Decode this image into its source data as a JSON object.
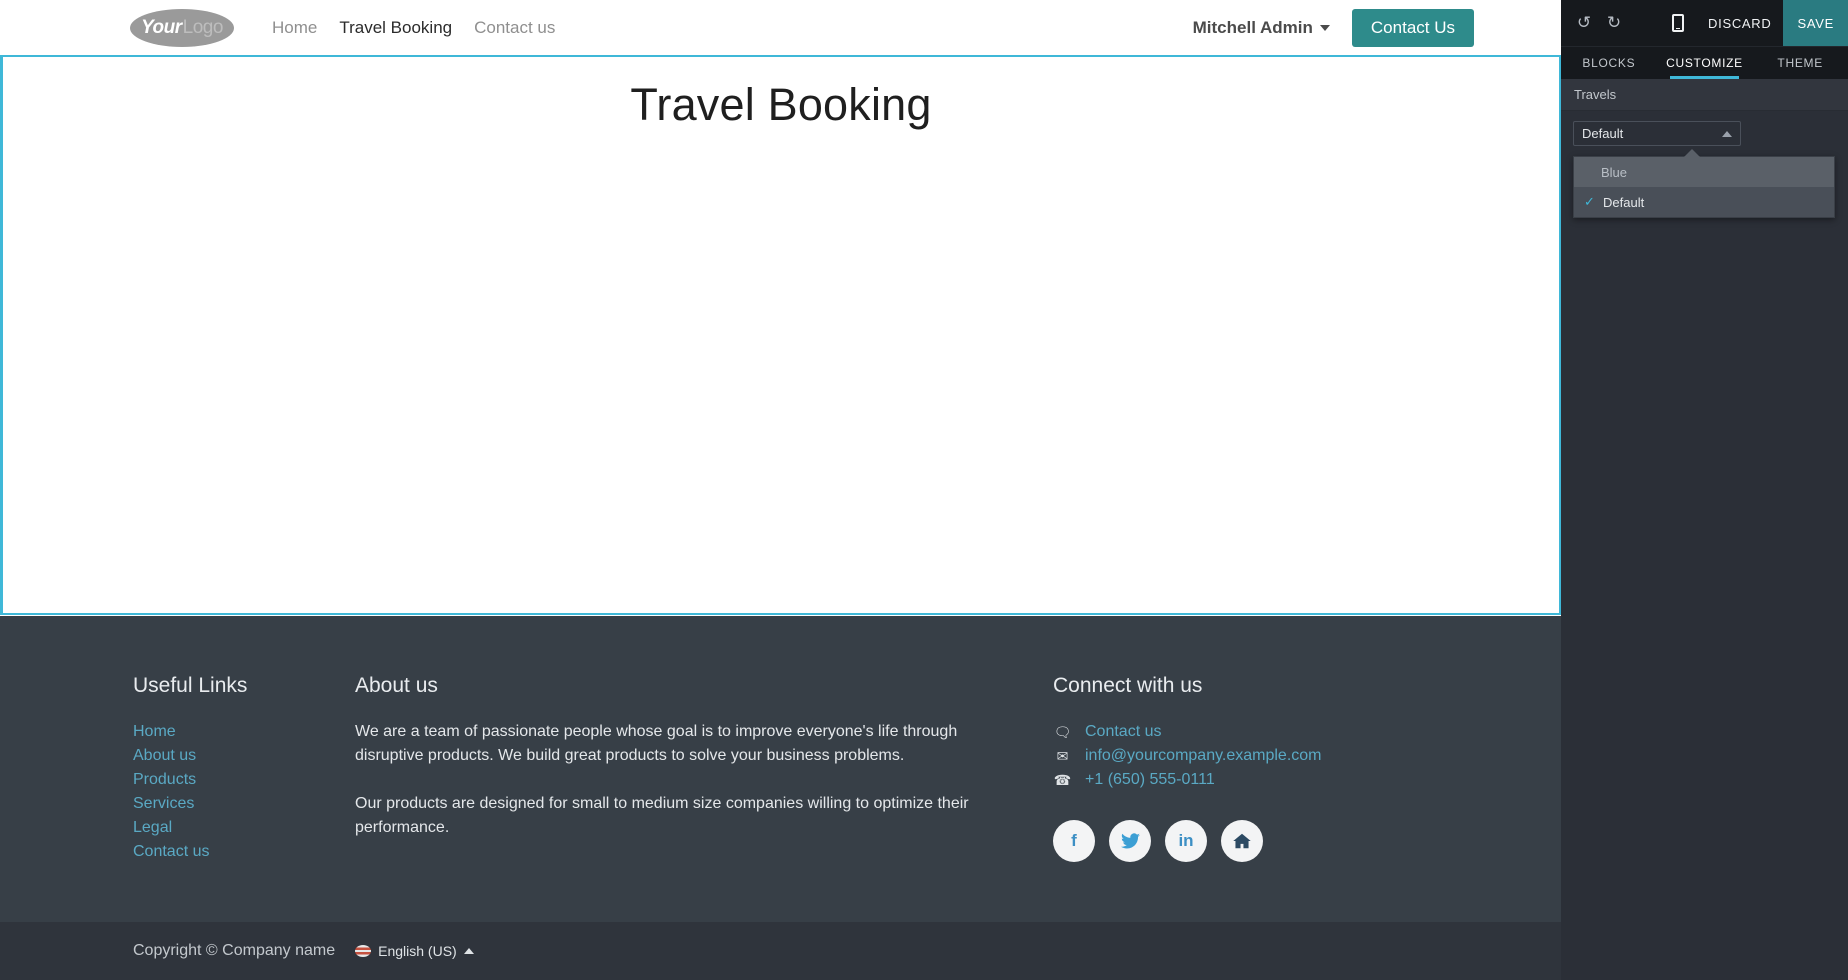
{
  "site": {
    "logo": {
      "part1": "Your",
      "part2": "Logo"
    },
    "nav": [
      {
        "label": "Home",
        "active": false
      },
      {
        "label": "Travel Booking",
        "active": true
      },
      {
        "label": "Contact us",
        "active": false
      }
    ],
    "user_menu": "Mitchell Admin",
    "cta_button": "Contact Us",
    "page_title": "Travel Booking",
    "accent_teal": "#2e8b8b",
    "edit_border": "#3fb8d8"
  },
  "footer": {
    "useful_links": {
      "heading": "Useful Links",
      "items": [
        "Home",
        "About us",
        "Products",
        "Services",
        "Legal",
        "Contact us"
      ]
    },
    "about": {
      "heading": "About us",
      "paragraph1": "We are a team of passionate people whose goal is to improve everyone's life through disruptive products. We build great products to solve your business problems.",
      "paragraph2": "Our products are designed for small to medium size companies willing to optimize their performance."
    },
    "connect": {
      "heading": "Connect with us",
      "contacts": [
        {
          "icon": "comment-icon",
          "glyph": "὞8",
          "label": "Contact us"
        },
        {
          "icon": "envelope-icon",
          "glyph": "✉",
          "label": "info@yourcompany.example.com"
        },
        {
          "icon": "phone-icon",
          "glyph": "☎",
          "label": "+1 (650) 555-0111"
        }
      ],
      "socials": [
        {
          "name": "facebook-icon",
          "glyph": "f"
        },
        {
          "name": "twitter-icon",
          "glyph": "ὂ6"
        },
        {
          "name": "linkedin-icon",
          "glyph": "in"
        },
        {
          "name": "home-icon",
          "glyph": "⌂"
        }
      ]
    },
    "copyright": "Copyright © Company name",
    "language": "English (US)",
    "bg": "#373f47",
    "copybar_bg": "#2f343c",
    "link_color": "#5aa9c4"
  },
  "editor": {
    "toolbar": {
      "undo": "↺",
      "redo": "↻",
      "mobile_preview": "mobile-preview-icon",
      "discard": "DISCARD",
      "save": "SAVE",
      "save_bg": "#2a7b81"
    },
    "tabs": [
      {
        "label": "BLOCKS",
        "active": false
      },
      {
        "label": "CUSTOMIZE",
        "active": true
      },
      {
        "label": "THEME",
        "active": false
      }
    ],
    "section_title": "Travels",
    "select": {
      "value": "Default",
      "options": [
        {
          "label": "Blue",
          "selected": false,
          "hovered": true
        },
        {
          "label": "Default",
          "selected": true,
          "hovered": false
        }
      ]
    },
    "panel_bg": "#2b2f37",
    "tab_accent": "#3fb8d8"
  }
}
